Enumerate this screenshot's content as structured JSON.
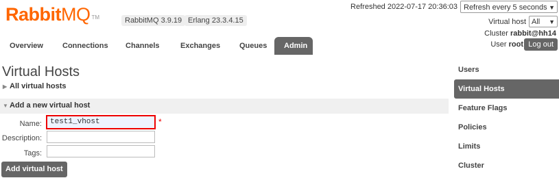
{
  "header": {
    "logo_text_1": "Rabbit",
    "logo_text_2": "MQ",
    "logo_tm": "TM",
    "version": "RabbitMQ 3.9.19",
    "erlang": "Erlang 23.3.4.15",
    "refreshed": "Refreshed 2022-07-17 20:36:03",
    "refresh_select": "Refresh every 5 seconds",
    "vhost_label": "Virtual host",
    "vhost_value": "All",
    "cluster_label": "Cluster",
    "cluster_value": "rabbit@hh14",
    "user_label": "User",
    "user_value": "root",
    "logout": "Log out"
  },
  "tabs": [
    {
      "label": "Overview"
    },
    {
      "label": "Connections"
    },
    {
      "label": "Channels"
    },
    {
      "label": "Exchanges"
    },
    {
      "label": "Queues"
    },
    {
      "label": "Admin"
    }
  ],
  "main": {
    "title": "Virtual Hosts",
    "all_vhosts": "All virtual hosts",
    "add_section": "Add a new virtual host",
    "name_label": "Name:",
    "name_value": "test1_vhost",
    "description_label": "Description:",
    "tags_label": "Tags:",
    "required_star": "*",
    "add_button": "Add virtual host"
  },
  "sidebar": {
    "items": [
      {
        "label": "Users"
      },
      {
        "label": "Virtual Hosts"
      },
      {
        "label": "Feature Flags"
      },
      {
        "label": "Policies"
      },
      {
        "label": "Limits"
      },
      {
        "label": "Cluster"
      }
    ]
  },
  "colors": {
    "brand": "#ff6600",
    "active_tab": "#666666",
    "required": "#ee0000"
  }
}
